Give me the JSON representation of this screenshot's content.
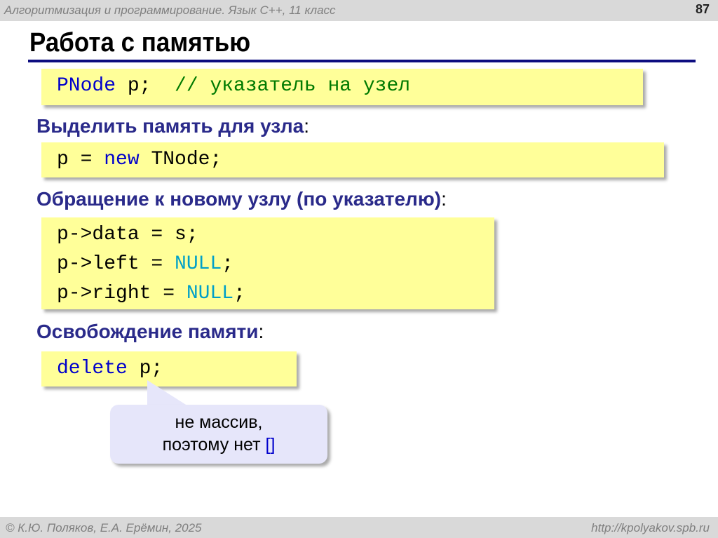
{
  "header": {
    "course": "Алгоритмизация и программирование. Язык С++, 11 класс",
    "page": "87"
  },
  "title": "Работа с памятью",
  "code1": {
    "type": "PNode",
    "rest": " p;  ",
    "comment": "// указатель на узел"
  },
  "heading1": {
    "text": "Выделить память для узла",
    "colon": ":"
  },
  "code2": {
    "a": "p = ",
    "kw": "new",
    "b": " TNode;"
  },
  "heading2": {
    "text": "Обращение к новому узлу (по указателю)",
    "colon": ":"
  },
  "code3": {
    "l1": "p->data = s;",
    "l2a": "p->left = ",
    "l2b": "NULL",
    "l2c": ";",
    "l3a": "p->right = ",
    "l3b": "NULL",
    "l3c": ";"
  },
  "heading3": {
    "text": "Освобождение памяти",
    "colon": ":"
  },
  "code4": {
    "kw": "delete",
    "rest": " p;"
  },
  "callout": {
    "line1": "не массив,",
    "line2": "поэтому нет ",
    "brackets": "[]"
  },
  "footer": {
    "authors": "© К.Ю. Поляков, Е.А. Ерёмин, 2025",
    "url": "http://kpolyakov.spb.ru"
  }
}
